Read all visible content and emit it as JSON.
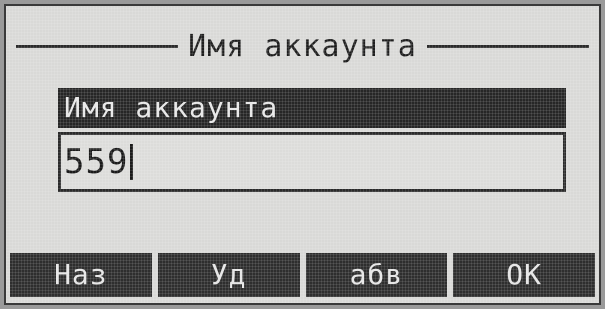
{
  "screen": {
    "title": "Имя аккаунта"
  },
  "field": {
    "label": "Имя аккаунта",
    "value": "559"
  },
  "softkeys": [
    {
      "label": "Наз"
    },
    {
      "label": "Уд"
    },
    {
      "label": "абв"
    },
    {
      "label": "ОК"
    }
  ]
}
